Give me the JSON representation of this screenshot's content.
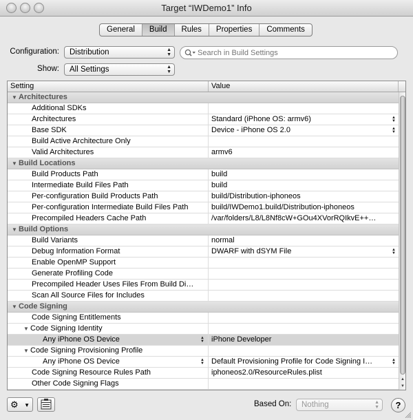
{
  "window": {
    "title": "Target “IWDemo1” Info"
  },
  "tabs": [
    "General",
    "Build",
    "Rules",
    "Properties",
    "Comments"
  ],
  "active_tab": "Build",
  "configuration": {
    "label": "Configuration:",
    "value": "Distribution"
  },
  "show": {
    "label": "Show:",
    "value": "All Settings"
  },
  "search": {
    "placeholder": "Search in Build Settings"
  },
  "table": {
    "headers": {
      "setting": "Setting",
      "value": "Value"
    },
    "rows": [
      {
        "type": "section",
        "setting": "Architectures"
      },
      {
        "setting": "Additional SDKs",
        "value": ""
      },
      {
        "setting": "Architectures",
        "value": "Standard (iPhone OS: armv6)",
        "stepper": true
      },
      {
        "setting": "Base SDK",
        "value": "Device - iPhone OS 2.0",
        "stepper": true
      },
      {
        "setting": "Build Active Architecture Only",
        "checkbox": false
      },
      {
        "setting": "Valid Architectures",
        "value": "armv6"
      },
      {
        "type": "section",
        "setting": "Build Locations"
      },
      {
        "setting": "Build Products Path",
        "value": "build"
      },
      {
        "setting": "Intermediate Build Files Path",
        "value": "build"
      },
      {
        "setting": "Per-configuration Build Products Path",
        "value": "build/Distribution-iphoneos"
      },
      {
        "setting": "Per-configuration Intermediate Build Files Path",
        "value": "build/IWDemo1.build/Distribution-iphoneos"
      },
      {
        "setting": "Precompiled Headers Cache Path",
        "value": "/var/folders/L8/L8Nf8cW+GOu4XVorRQIkvE++…"
      },
      {
        "type": "section",
        "setting": "Build Options"
      },
      {
        "setting": "Build Variants",
        "value": "normal"
      },
      {
        "setting": "Debug Information Format",
        "value": "DWARF with dSYM File",
        "stepper": true
      },
      {
        "setting": "Enable OpenMP Support",
        "checkbox": false
      },
      {
        "setting": "Generate Profiling Code",
        "checkbox": false
      },
      {
        "setting": "Precompiled Header Uses Files From Build Di…",
        "checkbox": true
      },
      {
        "setting": "Scan All Source Files for Includes",
        "checkbox": false
      },
      {
        "type": "section",
        "setting": "Code Signing"
      },
      {
        "setting": "Code Signing Entitlements",
        "value": ""
      },
      {
        "setting": "Code Signing Identity",
        "value": "",
        "expanded": true
      },
      {
        "setting": "Any iPhone OS Device",
        "value": "iPhone Developer",
        "sub": true,
        "selected": true,
        "stepperLeft": true
      },
      {
        "setting": "Code Signing Provisioning Profile",
        "value": "",
        "expanded": true,
        "stepper": true
      },
      {
        "setting": "Any iPhone OS Device",
        "value": "Default Provisioning Profile for Code Signing I…",
        "sub": true,
        "stepper": true,
        "stepperLeft": true
      },
      {
        "setting": "Code Signing Resource Rules Path",
        "value": "iphoneos2.0/ResourceRules.plist"
      },
      {
        "setting": "Other Code Signing Flags",
        "value": ""
      }
    ]
  },
  "footer": {
    "based_on_label": "Based On:",
    "based_on_value": "Nothing",
    "help_label": "?"
  },
  "icons": {
    "gear": "gear-icon",
    "search": "search-icon",
    "help": "help-icon"
  }
}
